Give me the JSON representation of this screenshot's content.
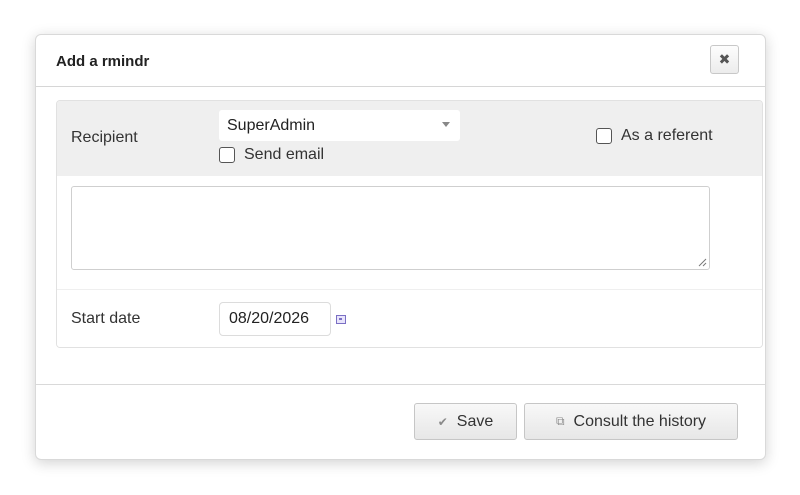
{
  "dialog": {
    "title": "Add a rmindr",
    "close_icon": "close-icon",
    "close_glyph": "✖"
  },
  "form": {
    "recipient_label": "Recipient",
    "recipient_value": "SuperAdmin",
    "send_email_label": "Send email",
    "send_email_checked": false,
    "referent_label": "As a referent",
    "referent_checked": false,
    "message_value": "",
    "start_date_label": "Start date",
    "start_date_value": "08/20/2026"
  },
  "footer": {
    "save_label": "Save",
    "save_icon": "checkmark-icon",
    "save_glyph": "✔",
    "history_label": "Consult the history",
    "history_icon": "external-link-icon",
    "history_glyph": "⧉"
  },
  "colors": {
    "panel_background": "#efefef",
    "calendar_icon": "#7a6fc4"
  }
}
